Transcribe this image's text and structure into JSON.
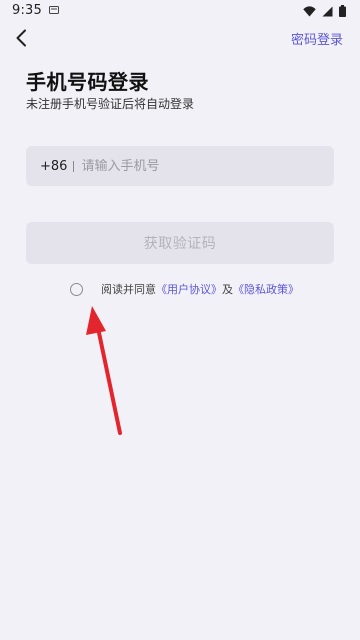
{
  "status_bar": {
    "time": "9:35",
    "icons": [
      "notification-icon",
      "wifi-icon",
      "signal-icon",
      "battery-icon"
    ]
  },
  "header": {
    "back_icon": "back-arrow-icon",
    "password_login": "密码登录"
  },
  "main": {
    "title": "手机号码登录",
    "subtitle": "未注册手机号验证后将自动登录",
    "phone": {
      "country_code": "+86",
      "value": "",
      "placeholder": "请输入手机号"
    },
    "get_code_button": "获取验证码",
    "agreement": {
      "checked": false,
      "prefix": "阅读并同意",
      "user_agreement": "《用户协议》",
      "and": "及",
      "privacy_policy": "《隐私政策》"
    }
  },
  "annotation": {
    "type": "red-arrow",
    "points_to": "agreement-radio",
    "color": "#e3262e"
  },
  "colors": {
    "background": "#f2f1f7",
    "accent": "#5c57d8",
    "field_bg": "#e4e3eb",
    "disabled_text": "#b3b2ba"
  }
}
